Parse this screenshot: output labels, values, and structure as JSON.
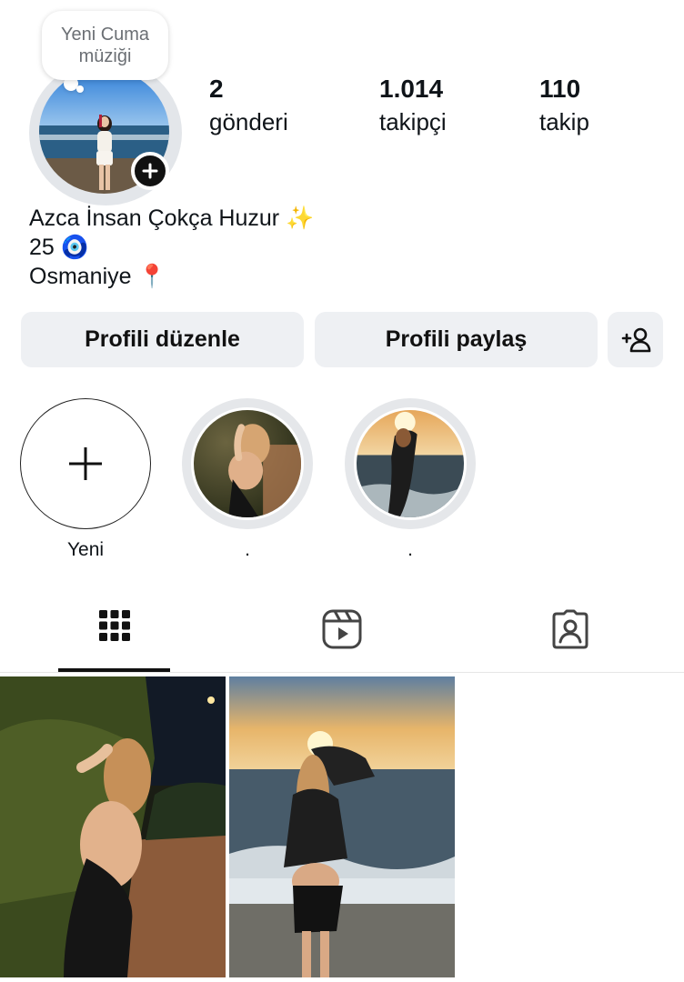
{
  "note": {
    "text": "Yeni Cuma\nmüziği"
  },
  "stats": {
    "posts": {
      "value": "2",
      "label": "gönderi"
    },
    "followers": {
      "value": "1.014",
      "label": "takipçi"
    },
    "following": {
      "value": "110",
      "label": "takip"
    }
  },
  "bio": {
    "name": "Azca İnsan Çokça Huzur ✨",
    "age": "25 🧿",
    "location": "Osmaniye 📍"
  },
  "actions": {
    "edit_profile": "Profili düzenle",
    "share_profile": "Profili paylaş",
    "discover_icon": "add-person-icon"
  },
  "highlights": [
    {
      "label": "Yeni",
      "icon": "plus-icon"
    },
    {
      "label": "."
    },
    {
      "label": "."
    }
  ],
  "tabs": [
    {
      "icon": "grid-icon",
      "active": true
    },
    {
      "icon": "reels-icon",
      "active": false
    },
    {
      "icon": "tagged-icon",
      "active": false
    }
  ],
  "colors": {
    "button_bg": "#eef0f3",
    "ring": "#e5e7ea",
    "text": "#0f1419",
    "note_text": "#6b6f74"
  }
}
